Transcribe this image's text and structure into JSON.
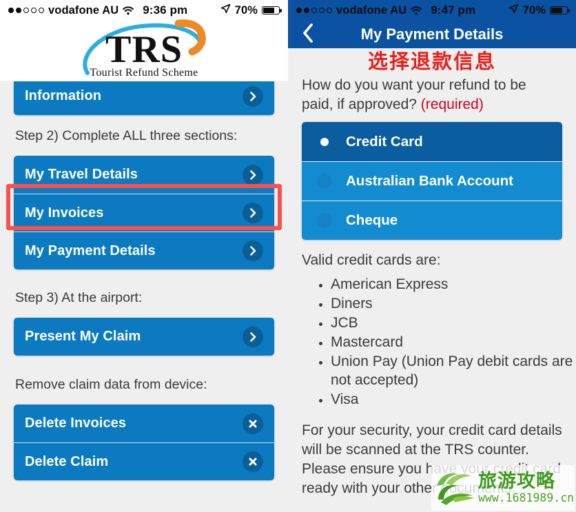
{
  "left": {
    "status": {
      "signal_filled": 2,
      "signal_total": 5,
      "carrier": "vodafone AU",
      "time": "9:36 pm",
      "battery_pct": "70%",
      "battery_level": 70
    },
    "logo": {
      "mark": "TRS",
      "tagline": "Tourist Refund Scheme"
    },
    "partial_button": {
      "label": "Information",
      "icon": "chevron-right-icon"
    },
    "step2_label": "Step 2) Complete ALL three sections:",
    "step2_buttons": [
      {
        "label": "My Travel Details",
        "icon": "chevron-right-icon",
        "highlighted": false
      },
      {
        "label": "My Invoices",
        "icon": "chevron-right-icon",
        "highlighted": false
      },
      {
        "label": "My Payment Details",
        "icon": "chevron-right-icon",
        "highlighted": true
      }
    ],
    "step3_label": "Step 3) At the airport:",
    "step3_buttons": [
      {
        "label": "Present My Claim",
        "icon": "chevron-right-icon"
      }
    ],
    "remove_label": "Remove claim data from device:",
    "remove_buttons": [
      {
        "label": "Delete Invoices",
        "icon": "close-x-icon"
      },
      {
        "label": "Delete Claim",
        "icon": "close-x-icon"
      }
    ]
  },
  "right": {
    "status": {
      "signal_filled": 2,
      "signal_total": 5,
      "carrier": "vodafone AU",
      "time": "9:47 pm",
      "battery_pct": "70%",
      "battery_level": 70
    },
    "nav": {
      "back_icon": "chevron-left-icon",
      "title": "My Payment Details"
    },
    "annotation_cn": "选择退款信息",
    "question_line1": "How do you want your refund to be",
    "question_line2": "paid, if approved? ",
    "required_text": "(required)",
    "options": [
      {
        "label": "Credit Card",
        "selected": true
      },
      {
        "label": "Australian Bank Account",
        "selected": false
      },
      {
        "label": "Cheque",
        "selected": false
      }
    ],
    "valid_cards_label": "Valid credit cards are:",
    "valid_cards": [
      "American Express",
      "Diners",
      "JCB",
      "Mastercard",
      "Union Pay (Union Pay debit cards are not accepted)",
      "Visa"
    ],
    "security_note": "For your security, your credit card details will be scanned at the TRS counter. Please ensure you have your credit card ready with your other documents.",
    "watermark": {
      "cn": "旅游攻略",
      "url": "www.1681989.cn"
    }
  },
  "colors": {
    "button_blue": "#0b7ac0",
    "nav_blue": "#0b52a3",
    "selected_blue": "#0a5d9e",
    "option_blue": "#128bd1",
    "highlight_red": "#f8504f",
    "required_red": "#d0021b",
    "annotation_red": "#e8201b",
    "watermark_green": "#3f9a1e",
    "page_bg": "#f0efef"
  }
}
